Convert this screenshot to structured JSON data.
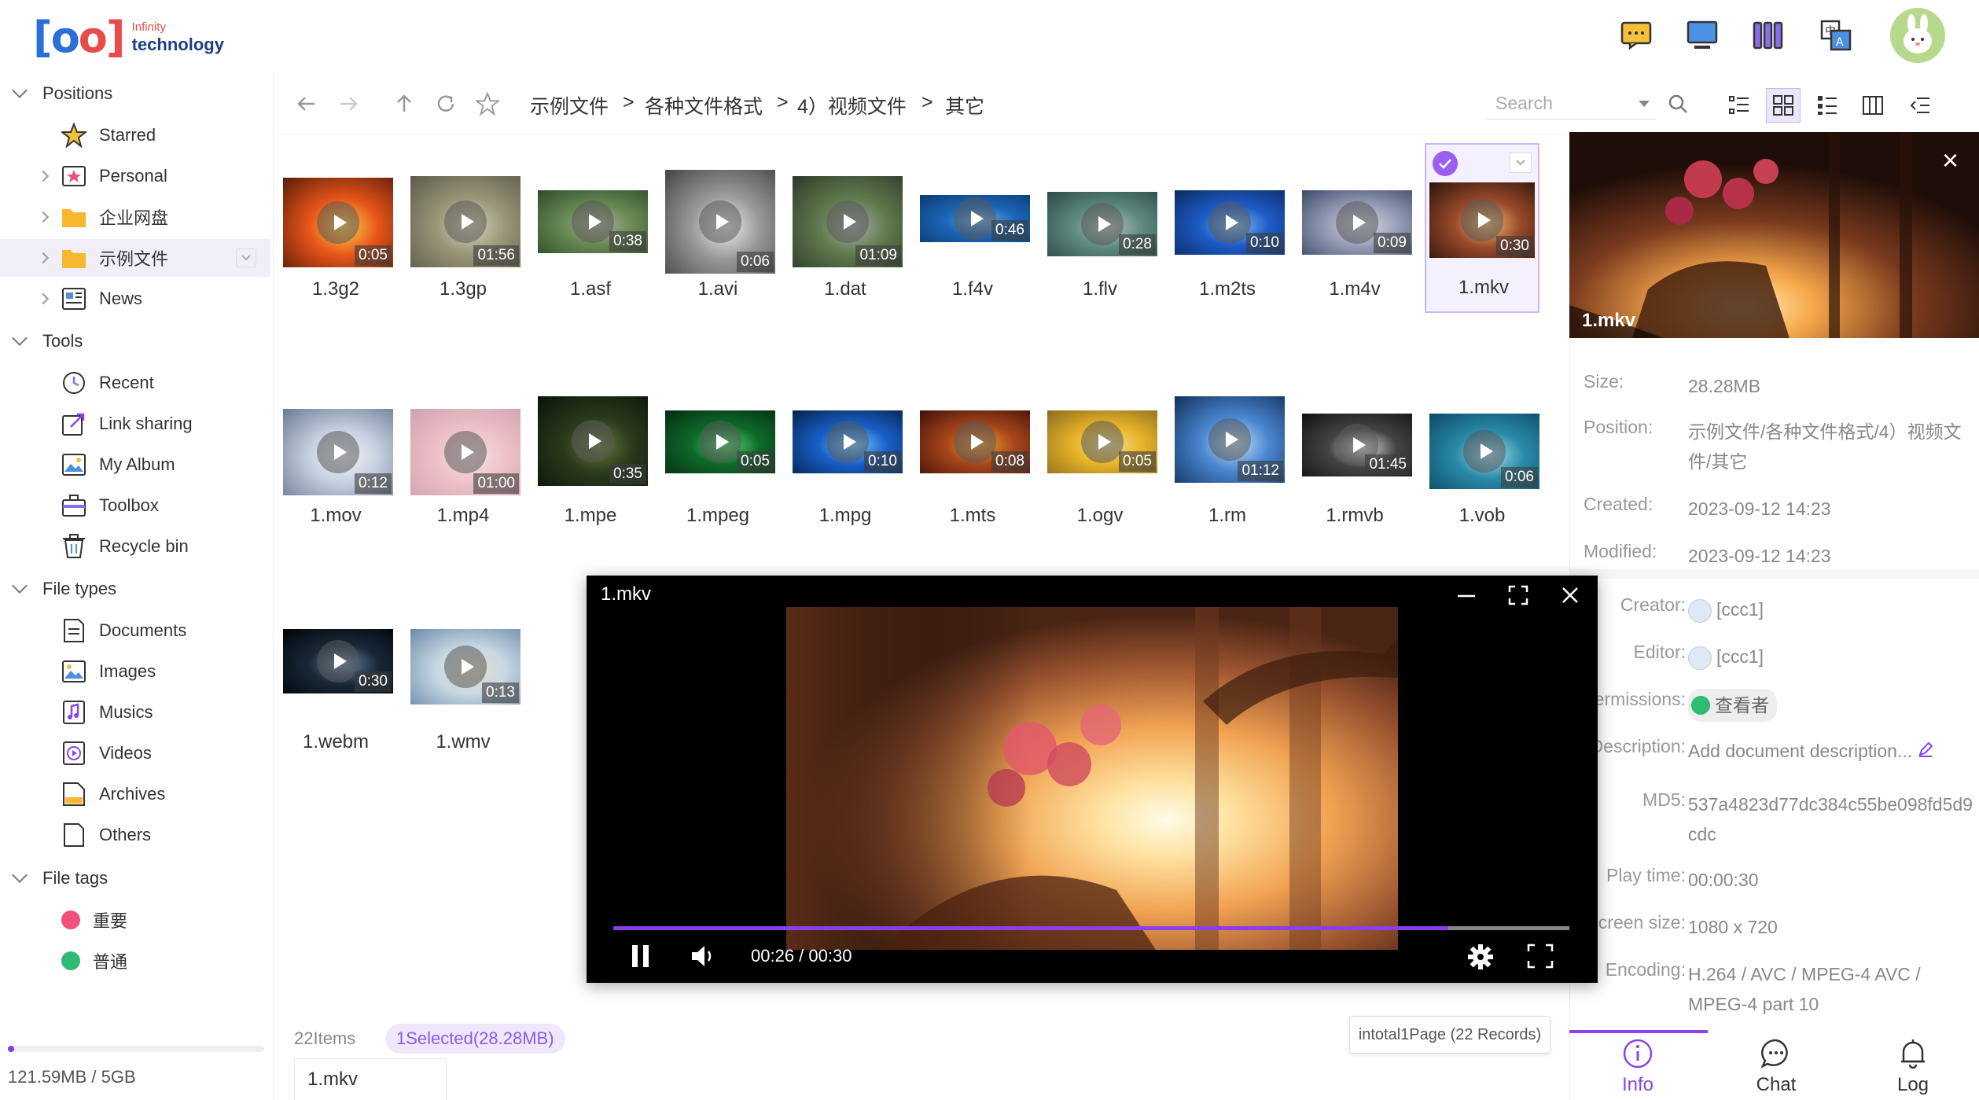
{
  "header": {
    "logo_small": "Infinity",
    "logo_main": "technology"
  },
  "sidebar": {
    "sections": {
      "positions": "Positions",
      "tools": "Tools",
      "file_types": "File types",
      "file_tags": "File tags"
    },
    "positions": [
      {
        "label": "Starred",
        "icon": "star-icon"
      },
      {
        "label": "Personal",
        "icon": "personal-star-folder-icon"
      },
      {
        "label": "企业网盘",
        "icon": "folder-icon"
      },
      {
        "label": "示例文件",
        "icon": "folder-icon"
      },
      {
        "label": "News",
        "icon": "news-icon"
      }
    ],
    "tools": [
      {
        "label": "Recent",
        "icon": "clock-icon"
      },
      {
        "label": "Link sharing",
        "icon": "link-share-icon"
      },
      {
        "label": "My Album",
        "icon": "album-icon"
      },
      {
        "label": "Toolbox",
        "icon": "toolbox-icon"
      },
      {
        "label": "Recycle bin",
        "icon": "trash-icon"
      }
    ],
    "file_types": [
      {
        "label": "Documents",
        "icon": "document-icon"
      },
      {
        "label": "Images",
        "icon": "image-icon"
      },
      {
        "label": "Musics",
        "icon": "music-icon"
      },
      {
        "label": "Videos",
        "icon": "video-icon"
      },
      {
        "label": "Archives",
        "icon": "archive-icon"
      },
      {
        "label": "Others",
        "icon": "file-icon"
      }
    ],
    "file_tags": [
      {
        "label": "重要",
        "color": "#f0507a"
      },
      {
        "label": "普通",
        "color": "#2ebc73"
      }
    ],
    "storage": "121.59MB / 5GB",
    "storage_fraction": 0.024
  },
  "toolbar": {
    "breadcrumb": [
      "示例文件",
      "各种文件格式",
      "4）视频文件",
      "其它"
    ],
    "search_placeholder": "Search"
  },
  "files": [
    {
      "name": "1.3g2",
      "duration": "0:05"
    },
    {
      "name": "1.3gp",
      "duration": "01:56"
    },
    {
      "name": "1.asf",
      "duration": "0:38"
    },
    {
      "name": "1.avi",
      "duration": "0:06"
    },
    {
      "name": "1.dat",
      "duration": "01:09"
    },
    {
      "name": "1.f4v",
      "duration": "0:46"
    },
    {
      "name": "1.flv",
      "duration": "0:28"
    },
    {
      "name": "1.m2ts",
      "duration": "0:10"
    },
    {
      "name": "1.m4v",
      "duration": "0:09"
    },
    {
      "name": "1.mkv",
      "duration": "0:30"
    },
    {
      "name": "1.mov",
      "duration": "0:12"
    },
    {
      "name": "1.mp4",
      "duration": "01:00"
    },
    {
      "name": "1.mpe",
      "duration": "0:35"
    },
    {
      "name": "1.mpeg",
      "duration": "0:05"
    },
    {
      "name": "1.mpg",
      "duration": "0:10"
    },
    {
      "name": "1.mts",
      "duration": "0:08"
    },
    {
      "name": "1.ogv",
      "duration": "0:05"
    },
    {
      "name": "1.rm",
      "duration": "01:12"
    },
    {
      "name": "1.rmvb",
      "duration": "01:45"
    },
    {
      "name": "1.vob",
      "duration": "0:06"
    },
    {
      "name": "1.webm",
      "duration": "0:30"
    },
    {
      "name": "1.wmv",
      "duration": "0:13"
    }
  ],
  "status": {
    "items": "22Items",
    "selected": "1Selected(28.28MB)",
    "name_field": "1.mkv",
    "pager": "intotal1Page (22 Records)"
  },
  "panel": {
    "preview_name": "1.mkv",
    "rows": [
      {
        "key": "Size:",
        "value": "28.28MB"
      },
      {
        "key": "Position:",
        "value": "示例文件/各种文件格式/4）视频文件/其它"
      },
      {
        "key": "Created:",
        "value": "2023-09-12 14:23"
      },
      {
        "key": "Modified:",
        "value": "2023-09-12 14:23"
      },
      {
        "key": "Creator:",
        "value": "[ccc1]"
      },
      {
        "key": "Editor:",
        "value": "[ccc1]"
      },
      {
        "key": "Permissions:",
        "value": "查看者"
      },
      {
        "key": "Description:",
        "value": "Add document description..."
      },
      {
        "key": "MD5:",
        "value": "537a4823d77dc384c55be098fd5d9cdc"
      },
      {
        "key": "Play time:",
        "value": "00:00:30"
      },
      {
        "key": "Screen size:",
        "value": "1080 x 720"
      },
      {
        "key": "Encoding:",
        "value": "H.264 / AVC / MPEG-4 AVC / MPEG-4 part 10"
      }
    ],
    "tabs": [
      {
        "label": "Info",
        "icon": "info-icon"
      },
      {
        "label": "Chat",
        "icon": "chat-icon"
      },
      {
        "label": "Log",
        "icon": "bell-icon"
      }
    ]
  },
  "player": {
    "title": "1.mkv",
    "time": "00:26 / 00:30",
    "progress": 0.873
  }
}
